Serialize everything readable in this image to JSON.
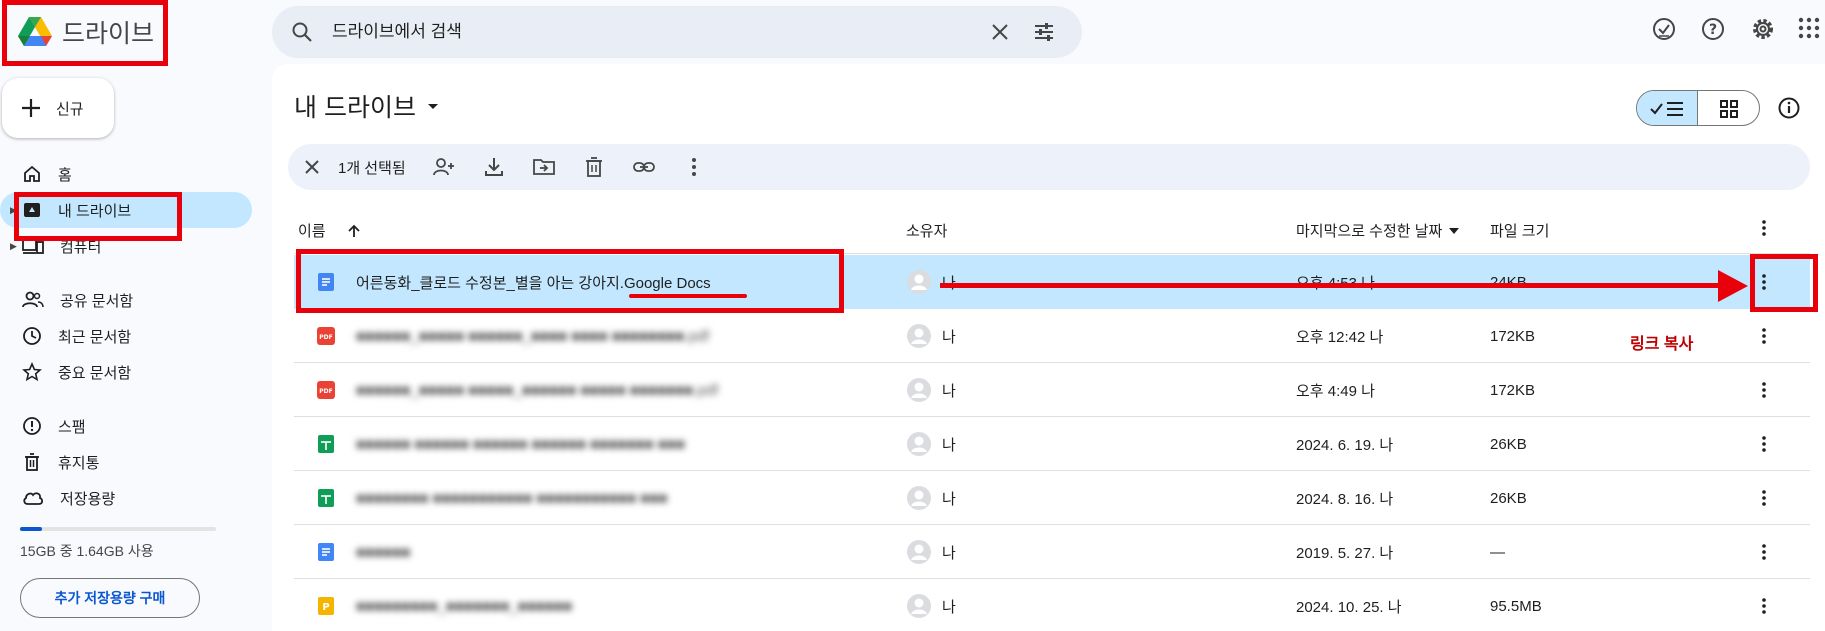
{
  "app": {
    "brand": "드라이브"
  },
  "search": {
    "placeholder": "드라이브에서 검색"
  },
  "sidebar": {
    "new_label": "신규",
    "items": [
      {
        "label": "홈"
      },
      {
        "label": "내 드라이브"
      },
      {
        "label": "컴퓨터"
      },
      {
        "label": "공유 문서함"
      },
      {
        "label": "최근 문서함"
      },
      {
        "label": "중요 문서함"
      },
      {
        "label": "스팸"
      },
      {
        "label": "휴지통"
      },
      {
        "label": "저장용량"
      }
    ],
    "storage_text": "15GB 중 1.64GB 사용",
    "storage_used_fraction": 0.11,
    "buy_label": "추가 저장용량 구매"
  },
  "main": {
    "title": "내 드라이브",
    "selection": {
      "count_label": "1개 선택됨"
    },
    "columns": {
      "name": "이름",
      "owner": "소유자",
      "modified": "마지막으로 수정한 날짜",
      "size": "파일 크기"
    },
    "rows": [
      {
        "type": "doc",
        "name": "어른동화_클로드 수정본_별을 아는 강아지.Google Docs",
        "owner": "나",
        "modified": "오후 4:53 나",
        "size": "24KB",
        "selected": true
      },
      {
        "type": "pdf",
        "name": "■■■■■■_■■■■■ ■■■■■■_■■■■ ■■■■ ■■■■■■■■.pdf",
        "owner": "나",
        "modified": "오후 12:42 나",
        "size": "172KB"
      },
      {
        "type": "pdf",
        "name": "■■■■■■_■■■■■ ■■■■■_■■■■■■ ■■■■■ ■■■■■■■.pdf",
        "owner": "나",
        "modified": "오후 4:49 나",
        "size": "172KB"
      },
      {
        "type": "sheet",
        "name": "■■■■■■ ■■■■■■ ■■■■■■ ■■■■■■ ■■■■■■■ ■■■",
        "owner": "나",
        "modified": "2024. 6. 19. 나",
        "size": "26KB"
      },
      {
        "type": "sheet",
        "name": "■■■■■■■■ ■■■■■■■■■■■ ■■■■■■■■■■■ ■■■",
        "owner": "나",
        "modified": "2024. 8. 16. 나",
        "size": "26KB"
      },
      {
        "type": "doc",
        "name": "■■■■■■",
        "owner": "나",
        "modified": "2019. 5. 27. 나",
        "size": "—"
      },
      {
        "type": "slides",
        "name": "■■■■■■■■■_■■■■■■■_■■■■■■",
        "owner": "나",
        "modified": "2024. 10. 25. 나",
        "size": "95.5MB"
      }
    ]
  },
  "annotation": {
    "text": "링크 복사"
  },
  "colors": {
    "accent": "#0b57d0",
    "selected_bg": "#c2e7ff",
    "annotation": "#e8000b"
  },
  "icons": [
    "drive-logo-icon",
    "search-icon",
    "close-icon",
    "tune-icon",
    "ready-offline-icon",
    "help-icon",
    "settings-icon",
    "apps-icon",
    "plus-icon",
    "home-icon",
    "my-drive-icon",
    "computer-icon",
    "shared-icon",
    "recent-icon",
    "star-icon",
    "spam-icon",
    "trash-icon",
    "cloud-icon",
    "dropdown-icon",
    "list-view-icon",
    "grid-view-icon",
    "info-icon",
    "share-icon",
    "download-icon",
    "move-icon",
    "link-icon",
    "more-vert-icon",
    "sort-up-icon",
    "avatar-icon",
    "doc-icon",
    "pdf-icon",
    "sheet-icon",
    "slides-icon"
  ]
}
